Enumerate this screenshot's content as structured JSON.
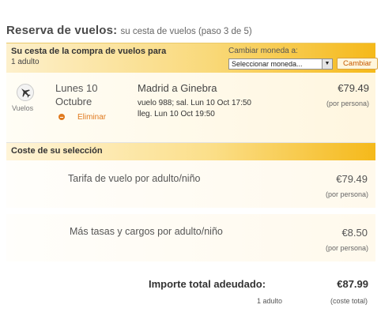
{
  "header": {
    "title_main": "Reserva de vuelos:",
    "title_sub": "su cesta de vuelos (paso 3 de 5)"
  },
  "cart": {
    "title": "Su cesta de la compra de vuelos para",
    "passengers": "1 adulto",
    "currency_label": "Cambiar moneda a:",
    "currency_placeholder": "Seleccionar moneda...",
    "currency_button": "Cambiar"
  },
  "flight": {
    "icon": "plane-icon",
    "icon_label": "Vuelos",
    "day": "Lunes 10",
    "month": "Octubre",
    "remove_label": "Eliminar",
    "route": "Madrid a Ginebra",
    "departure": "vuelo 988; sal. Lun 10 Oct 17:50",
    "arrival": "lleg. Lun 10 Oct 19:50",
    "price": "€79.49",
    "price_note": "(por persona)"
  },
  "costs": {
    "title": "Coste de su selección",
    "items": [
      {
        "label": "Tarifa de vuelo por adulto/niño",
        "price": "€79.49",
        "note": "(por persona)"
      },
      {
        "label": "Más tasas y cargos por adulto/niño",
        "price": "€8.50",
        "note": "(por persona)"
      }
    ]
  },
  "total": {
    "label": "Importe total adeudado:",
    "value": "€87.99",
    "passengers": "1 adulto",
    "note": "(coste total)"
  },
  "colors": {
    "accent_orange": "#e07a1f",
    "header_gold": "#f5b91a"
  }
}
